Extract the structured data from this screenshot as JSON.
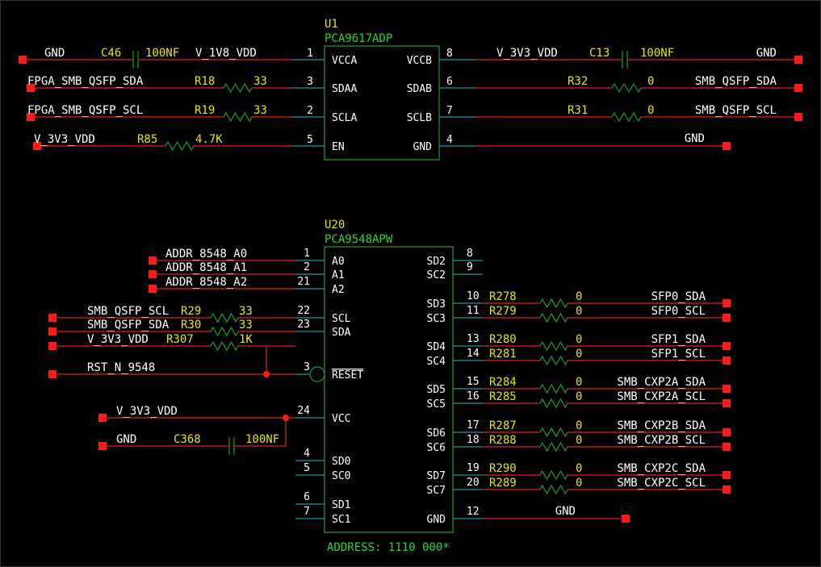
{
  "u1": {
    "ref": "U1",
    "part": "PCA9617ADP",
    "left_pins": [
      {
        "num": "1",
        "name": "VCCA"
      },
      {
        "num": "3",
        "name": "SDAA"
      },
      {
        "num": "2",
        "name": "SCLA"
      },
      {
        "num": "5",
        "name": "EN"
      }
    ],
    "right_pins": [
      {
        "num": "8",
        "name": "VCCB"
      },
      {
        "num": "6",
        "name": "SDAB"
      },
      {
        "num": "7",
        "name": "SCLB"
      },
      {
        "num": "4",
        "name": "GND"
      }
    ],
    "left_nets": [
      {
        "net": "GND",
        "net2": "V_1V8_VDD",
        "ref": "C46",
        "value": "100NF",
        "kind": "cap"
      },
      {
        "net": "FPGA_SMB_QSFP_SDA",
        "ref": "R18",
        "value": "33",
        "kind": "res"
      },
      {
        "net": "FPGA_SMB_QSFP_SCL",
        "ref": "R19",
        "value": "33",
        "kind": "res"
      },
      {
        "net": "V_3V3_VDD",
        "ref": "R85",
        "value": "4.7K",
        "kind": "res"
      }
    ],
    "right_nets": [
      {
        "net": "GND",
        "net2": "V_3V3_VDD",
        "ref": "C13",
        "value": "100NF",
        "kind": "cap"
      },
      {
        "net": "SMB_QSFP_SDA",
        "ref": "R32",
        "value": "0",
        "kind": "res"
      },
      {
        "net": "SMB_QSFP_SCL",
        "ref": "R31",
        "value": "0",
        "kind": "res"
      },
      {
        "net": "GND",
        "kind": "wire"
      }
    ]
  },
  "u20": {
    "ref": "U20",
    "part": "PCA9548APW",
    "address_note": "ADDRESS: 1110 000*",
    "left_pins": [
      {
        "num": "1",
        "name": "A0"
      },
      {
        "num": "2",
        "name": "A1"
      },
      {
        "num": "21",
        "name": "A2"
      },
      {
        "num": "22",
        "name": "SCL"
      },
      {
        "num": "23",
        "name": "SDA"
      },
      {
        "num": "3",
        "name": "RESET"
      },
      {
        "num": "24",
        "name": "VCC"
      },
      {
        "num": "4",
        "name": "SD0"
      },
      {
        "num": "5",
        "name": "SC0"
      },
      {
        "num": "6",
        "name": "SD1"
      },
      {
        "num": "7",
        "name": "SC1"
      }
    ],
    "right_pins": [
      {
        "num": "8",
        "name": "SD2"
      },
      {
        "num": "9",
        "name": "SC2"
      },
      {
        "num": "10",
        "name": "SD3"
      },
      {
        "num": "11",
        "name": "SC3"
      },
      {
        "num": "13",
        "name": "SD4"
      },
      {
        "num": "14",
        "name": "SC4"
      },
      {
        "num": "15",
        "name": "SD5"
      },
      {
        "num": "16",
        "name": "SC5"
      },
      {
        "num": "17",
        "name": "SD6"
      },
      {
        "num": "18",
        "name": "SC6"
      },
      {
        "num": "19",
        "name": "SD7"
      },
      {
        "num": "20",
        "name": "SC7"
      },
      {
        "num": "12",
        "name": "GND"
      }
    ],
    "addr_nets": [
      "ADDR_8548_A0",
      "ADDR_8548_A1",
      "ADDR_8548_A2"
    ],
    "left_res": [
      {
        "net": "SMB_QSFP_SCL",
        "ref": "R29",
        "value": "33"
      },
      {
        "net": "SMB_QSFP_SDA",
        "ref": "R30",
        "value": "33"
      },
      {
        "net": "V_3V3_VDD",
        "ref": "R307",
        "value": "1K"
      }
    ],
    "reset_net": "RST_N_9548",
    "vcc_net": "V_3V3_VDD",
    "gnd_cap": {
      "net": "GND",
      "ref": "C368",
      "value": "100NF"
    },
    "right_res": [
      {
        "ref": "R278",
        "value": "0",
        "net": "SFP0_SDA"
      },
      {
        "ref": "R279",
        "value": "0",
        "net": "SFP0_SCL"
      },
      {
        "ref": "R280",
        "value": "0",
        "net": "SFP1_SDA"
      },
      {
        "ref": "R281",
        "value": "0",
        "net": "SFP1_SCL"
      },
      {
        "ref": "R284",
        "value": "0",
        "net": "SMB_CXP2A_SDA"
      },
      {
        "ref": "R285",
        "value": "0",
        "net": "SMB_CXP2A_SCL"
      },
      {
        "ref": "R287",
        "value": "0",
        "net": "SMB_CXP2B_SDA"
      },
      {
        "ref": "R288",
        "value": "0",
        "net": "SMB_CXP2B_SCL"
      },
      {
        "ref": "R290",
        "value": "0",
        "net": "SMB_CXP2C_SDA"
      },
      {
        "ref": "R289",
        "value": "0",
        "net": "SMB_CXP2C_SCL"
      }
    ],
    "gnd_net": "GND"
  }
}
